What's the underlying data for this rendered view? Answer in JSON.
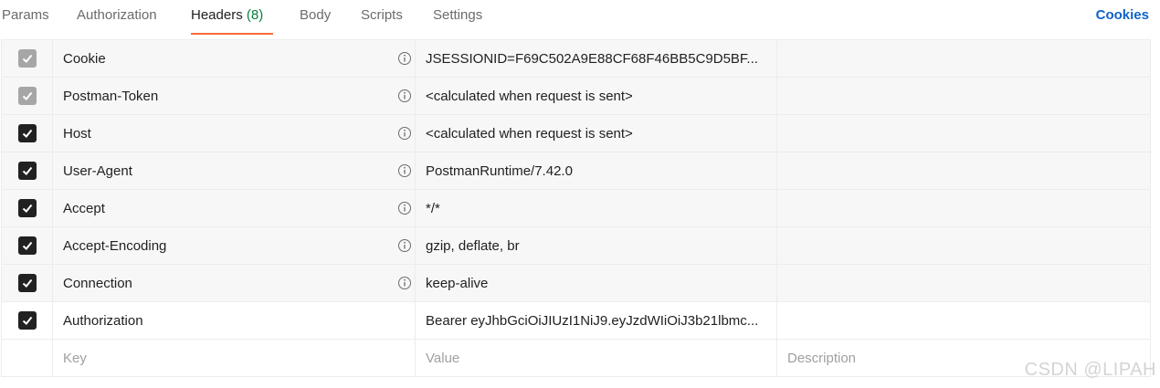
{
  "tabs": {
    "items": [
      {
        "label": "Params"
      },
      {
        "label": "Authorization"
      },
      {
        "label": "Headers",
        "count": "(8)"
      },
      {
        "label": "Body"
      },
      {
        "label": "Scripts"
      },
      {
        "label": "Settings"
      }
    ],
    "cookies": "Cookies"
  },
  "headers": {
    "rows": [
      {
        "key": "Cookie",
        "value": "JSESSIONID=F69C502A9E88CF68F46BB5C9D5BF...",
        "checked": true,
        "disabled": true
      },
      {
        "key": "Postman-Token",
        "value": "<calculated when request is sent>",
        "checked": true,
        "disabled": true
      },
      {
        "key": "Host",
        "value": "<calculated when request is sent>",
        "checked": true,
        "disabled": false
      },
      {
        "key": "User-Agent",
        "value": "PostmanRuntime/7.42.0",
        "checked": true,
        "disabled": false
      },
      {
        "key": "Accept",
        "value": "*/*",
        "checked": true,
        "disabled": false
      },
      {
        "key": "Accept-Encoding",
        "value": "gzip, deflate, br",
        "checked": true,
        "disabled": false
      },
      {
        "key": "Connection",
        "value": "keep-alive",
        "checked": true,
        "disabled": false
      },
      {
        "key": "Authorization",
        "value": "Bearer eyJhbGciOiJIUzI1NiJ9.eyJzdWIiOiJ3b21lbmc...",
        "checked": true,
        "disabled": false
      }
    ],
    "new_row": {
      "key_placeholder": "Key",
      "value_placeholder": "Value",
      "description_placeholder": "Description"
    }
  },
  "icons": {
    "checkbox": "check-icon",
    "info": "info-icon"
  },
  "colors": {
    "accent": "#ff6c37",
    "link": "#0f64c8",
    "count": "#0a7d3a"
  },
  "watermark": "CSDN @LIPAH"
}
